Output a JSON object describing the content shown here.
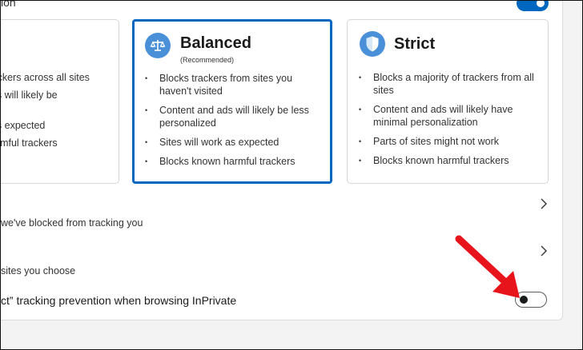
{
  "header": {
    "label": "ion"
  },
  "cards": {
    "basic": {
      "bullets": [
        "trackers across all sites",
        "ads will likely be",
        "",
        "t as expected",
        "harmful trackers"
      ]
    },
    "balanced": {
      "title": "Balanced",
      "subtitle": "(Recommended)",
      "bullets": [
        "Blocks trackers from sites you haven't visited",
        "Content and ads will likely be less personalized",
        "Sites will work as expected",
        "Blocks known harmful trackers"
      ]
    },
    "strict": {
      "title": "Strict",
      "bullets": [
        "Blocks a majority of trackers from all sites",
        "Content and ads will likely have minimal personalization",
        "Parts of sites might not work",
        "Blocks known harmful trackers"
      ]
    }
  },
  "rows": {
    "blocked_trackers": "we've blocked from tracking you",
    "exceptions": "sites you choose",
    "inprivate_strict": "ct” tracking prevention when browsing InPrivate"
  },
  "toggles": {
    "top_enabled": true,
    "inprivate_strict_enabled": false
  },
  "colors": {
    "accent": "#0067c0",
    "icon_bg": "#4a90d9",
    "arrow": "#e8141b"
  }
}
